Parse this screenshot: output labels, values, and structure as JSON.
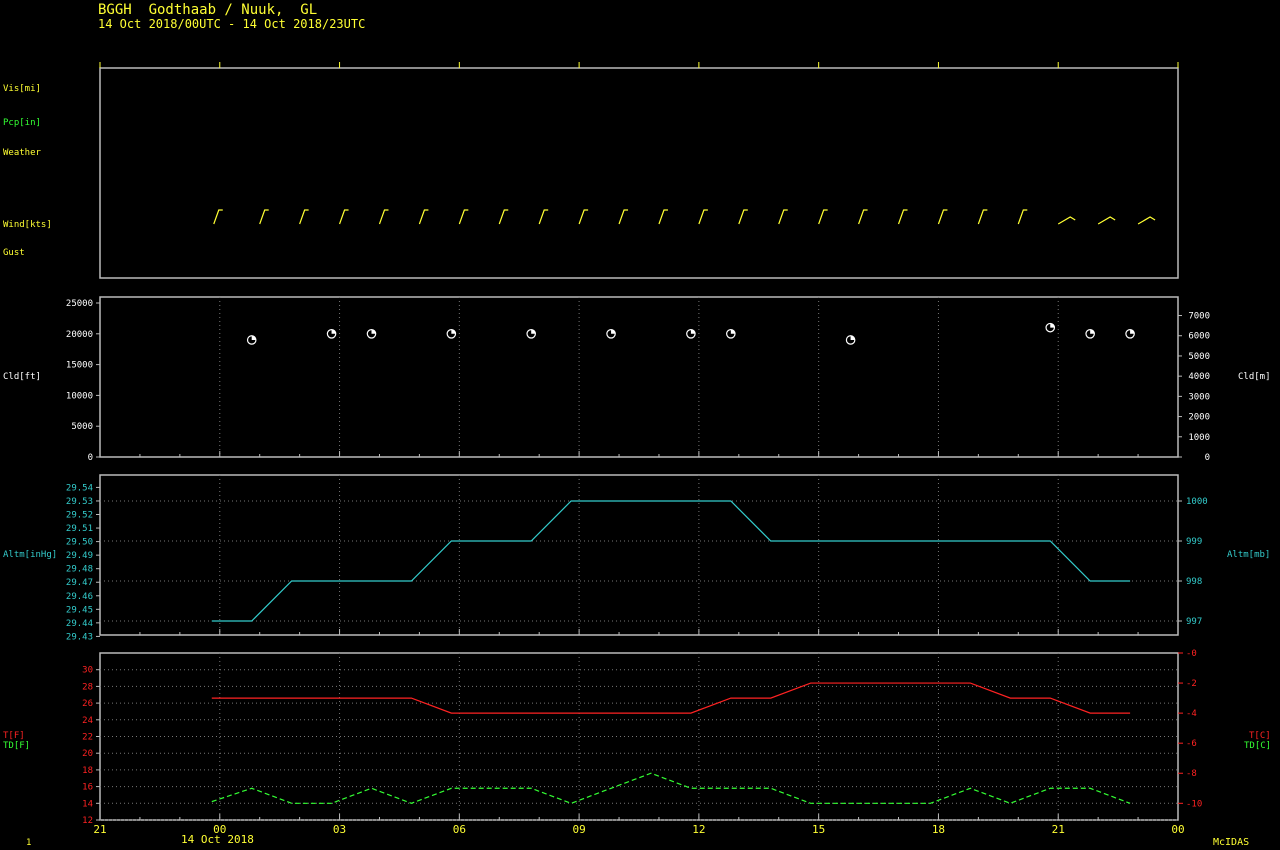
{
  "header": {
    "line1": "BGGH  Godthaab / Nuuk,  GL",
    "line2": "14 Oct 2018/00UTC - 14 Oct 2018/23UTC"
  },
  "footer": {
    "left_num": "1",
    "date": "14 Oct 2018",
    "brand": "McIDAS"
  },
  "labels": {
    "vis": "Vis[mi]",
    "pcp": "Pcp[in]",
    "weather": "Weather",
    "wind": "Wind[kts]",
    "gust": "Gust",
    "cld_ft": "Cld[ft]",
    "cld_m": "Cld[m]",
    "altm_inhg": "Altm[inHg]",
    "altm_mb": "Altm[mb]",
    "t_f": "T[F]",
    "td_f": "TD[F]",
    "t_c": "T[C]",
    "td_c": "TD[C]"
  },
  "colors": {
    "yellow": "#ffff33",
    "green": "#33ff33",
    "cyan": "#33cccc",
    "red": "#ff2222",
    "white": "#ffffff",
    "frame": "#bbbbbb"
  },
  "chart_data": {
    "type": "line",
    "x_axis": {
      "range_hours": [
        -3,
        24
      ],
      "ticks": [
        "21",
        "00",
        "03",
        "06",
        "09",
        "12",
        "15",
        "18",
        "21",
        "00"
      ],
      "date_label": "14 Oct 2018"
    },
    "wind_hours": [
      0,
      1,
      2,
      3,
      4,
      5,
      6,
      7,
      8,
      9,
      10,
      11,
      12,
      13,
      14,
      15,
      16,
      17,
      18,
      19,
      20,
      21,
      22,
      23
    ],
    "cloud": {
      "left_axis": {
        "label": "Cld[ft]",
        "range": [
          0,
          25000
        ],
        "ticks": [
          "0",
          "5000",
          "10000",
          "15000",
          "20000",
          "25000"
        ]
      },
      "right_axis": {
        "label": "Cld[m]",
        "range": [
          0,
          7620
        ],
        "ticks": [
          "0",
          "1000",
          "2000",
          "3000",
          "4000",
          "5000",
          "6000",
          "7000"
        ]
      },
      "points": [
        {
          "h": 0.8,
          "ft": 19000
        },
        {
          "h": 2.8,
          "ft": 20000
        },
        {
          "h": 3.8,
          "ft": 20000
        },
        {
          "h": 5.8,
          "ft": 20000
        },
        {
          "h": 7.8,
          "ft": 20000
        },
        {
          "h": 9.8,
          "ft": 20000
        },
        {
          "h": 11.8,
          "ft": 20000
        },
        {
          "h": 12.8,
          "ft": 20000
        },
        {
          "h": 15.8,
          "ft": 19000
        },
        {
          "h": 20.8,
          "ft": 21000
        },
        {
          "h": 21.8,
          "ft": 20000
        },
        {
          "h": 22.8,
          "ft": 20000
        }
      ]
    },
    "altimeter": {
      "left_axis": {
        "label": "Altm[inHg]",
        "range": [
          29.43,
          29.54
        ],
        "ticks": [
          "29.43",
          "29.44",
          "29.45",
          "29.46",
          "29.47",
          "29.48",
          "29.49",
          "29.50",
          "29.51",
          "29.52",
          "29.53",
          "29.54"
        ]
      },
      "right_axis": {
        "label": "Altm[mb]",
        "ticks": [
          "997",
          "998",
          "999",
          "1000"
        ]
      },
      "series": [
        {
          "h": -0.2,
          "mb": 997
        },
        {
          "h": 0.8,
          "mb": 997
        },
        {
          "h": 1.8,
          "mb": 998
        },
        {
          "h": 4.8,
          "mb": 998
        },
        {
          "h": 5.8,
          "mb": 999
        },
        {
          "h": 7.8,
          "mb": 999
        },
        {
          "h": 8.8,
          "mb": 1000
        },
        {
          "h": 12.8,
          "mb": 1000
        },
        {
          "h": 13.8,
          "mb": 999
        },
        {
          "h": 20.8,
          "mb": 999
        },
        {
          "h": 21.8,
          "mb": 998
        },
        {
          "h": 22.8,
          "mb": 998
        }
      ]
    },
    "temperature": {
      "left_axis": {
        "label": "T[F]",
        "range": [
          12,
          31
        ],
        "ticks": [
          "12",
          "14",
          "16",
          "18",
          "20",
          "22",
          "24",
          "26",
          "28",
          "30"
        ]
      },
      "right_axis": {
        "label": "T[C]",
        "ticks": [
          "-10",
          "-8",
          "-6",
          "-4",
          "-2",
          "-0"
        ]
      },
      "t_series": [
        {
          "h": -0.2,
          "f": 26.6
        },
        {
          "h": 4.8,
          "f": 26.6
        },
        {
          "h": 5.8,
          "f": 24.8
        },
        {
          "h": 11.8,
          "f": 24.8
        },
        {
          "h": 12.8,
          "f": 26.6
        },
        {
          "h": 13.8,
          "f": 26.6
        },
        {
          "h": 14.8,
          "f": 28.4
        },
        {
          "h": 18.8,
          "f": 28.4
        },
        {
          "h": 19.8,
          "f": 26.6
        },
        {
          "h": 20.8,
          "f": 26.6
        },
        {
          "h": 21.8,
          "f": 24.8
        },
        {
          "h": 22.8,
          "f": 24.8
        }
      ],
      "td_series": [
        {
          "h": -0.2,
          "f": 14.2
        },
        {
          "h": 0.8,
          "f": 15.8
        },
        {
          "h": 1.8,
          "f": 14.0
        },
        {
          "h": 2.8,
          "f": 14.0
        },
        {
          "h": 3.8,
          "f": 15.8
        },
        {
          "h": 4.8,
          "f": 14.0
        },
        {
          "h": 5.8,
          "f": 15.8
        },
        {
          "h": 7.8,
          "f": 15.8
        },
        {
          "h": 8.8,
          "f": 14.0
        },
        {
          "h": 9.8,
          "f": 15.8
        },
        {
          "h": 10.8,
          "f": 17.6
        },
        {
          "h": 11.8,
          "f": 15.8
        },
        {
          "h": 13.8,
          "f": 15.8
        },
        {
          "h": 14.8,
          "f": 14.0
        },
        {
          "h": 17.8,
          "f": 14.0
        },
        {
          "h": 18.8,
          "f": 15.8
        },
        {
          "h": 19.8,
          "f": 14.0
        },
        {
          "h": 20.8,
          "f": 15.8
        },
        {
          "h": 21.8,
          "f": 15.8
        },
        {
          "h": 22.8,
          "f": 14.0
        }
      ]
    }
  }
}
